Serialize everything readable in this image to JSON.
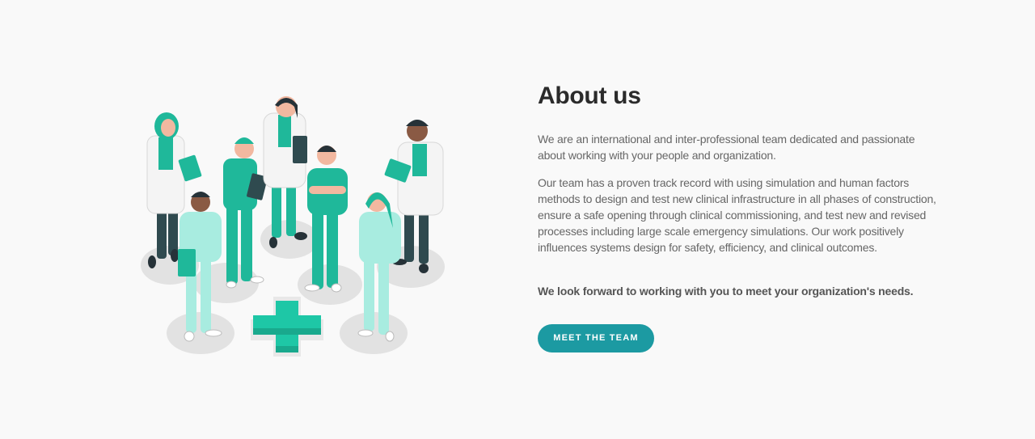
{
  "about": {
    "title": "About us",
    "paragraph1": "We are an international and inter-professional team dedicated and passionate about working with your people and organization.",
    "paragraph2": "Our team has a proven track record with using simulation and human factors methods to design and test new clinical infrastructure in all phases of construction, ensure a safe opening through clinical commissioning, and test new and revised processes including large scale emergency simulations. Our work positively influences systems design for safety, efficiency, and clinical outcomes.",
    "closing": "We look forward to working with you to meet your organization's needs.",
    "cta_label": "MEET THE TEAM"
  },
  "illustration": {
    "subject": "medical-team-illustration",
    "colors": {
      "scrubs": "#1fb89a",
      "scrubs_light": "#7ee0cd",
      "coat": "#f4f4f4",
      "pants_dark": "#2f4a4f",
      "skin": "#f2b8a0",
      "skin_dark": "#8a5a44",
      "hair": "#263238",
      "platform": "#e2e2e2",
      "cross": "#1ec7a6"
    }
  },
  "colors": {
    "background": "#f9f9f9",
    "accent": "#1c9aa2",
    "heading": "#2b2b2b",
    "body_text": "#666666"
  }
}
